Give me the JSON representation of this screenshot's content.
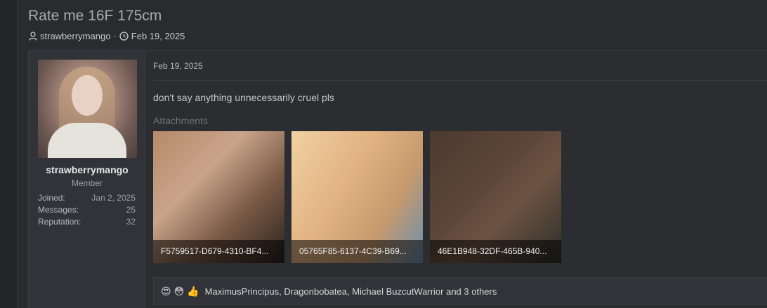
{
  "thread": {
    "title": "Rate me 16F 175cm",
    "author": "strawberrymango",
    "separator": "·",
    "date": "Feb 19, 2025"
  },
  "user": {
    "name": "strawberrymango",
    "title": "Member",
    "stats": [
      {
        "label": "Joined:",
        "value": "Jan 2, 2025"
      },
      {
        "label": "Messages:",
        "value": "25"
      },
      {
        "label": "Reputation:",
        "value": "32"
      }
    ]
  },
  "post": {
    "date": "Feb 19, 2025",
    "message": "don't say anything unnecessarily cruel pls",
    "attachments_heading": "Attachments",
    "attachments": [
      {
        "name": "F5759517-D679-4310-BF4..."
      },
      {
        "name": "05765F85-6137-4C39-B69..."
      },
      {
        "name": "46E1B948-32DF-465B-940..."
      }
    ]
  },
  "reactions": {
    "icons": [
      "😍",
      "😳",
      "👍"
    ],
    "text": "MaximusPrincipus, Dragonbobatea, Michael BuzcutWarrior and 3 others"
  }
}
